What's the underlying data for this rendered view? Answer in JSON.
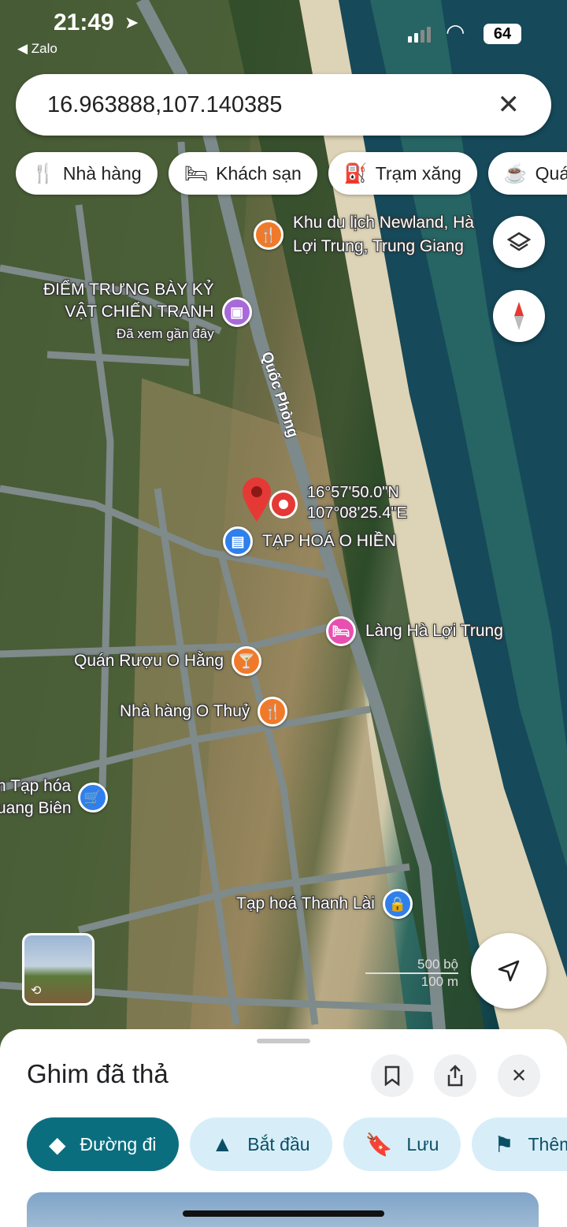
{
  "status_bar": {
    "time": "21:49",
    "back_app": "◀ Zalo",
    "battery": "64"
  },
  "search": {
    "query": "16.963888,107.140385",
    "close_icon": "close-icon"
  },
  "chips": [
    {
      "icon": "restaurant-icon",
      "glyph": "🍴",
      "label": "Nhà hàng"
    },
    {
      "icon": "hotel-icon",
      "glyph": "🛏",
      "label": "Khách sạn"
    },
    {
      "icon": "gas-station-icon",
      "glyph": "⛽",
      "label": "Trạm xăng"
    },
    {
      "icon": "cafe-icon",
      "glyph": "☕",
      "label": "Quán"
    }
  ],
  "map": {
    "road_label": "Quốc Phòng",
    "pin": {
      "lat": "16°57'50.0\"N",
      "lng": "107°08'25.4\"E"
    },
    "pois": [
      {
        "name": "Khu du lịch Newland, Hà",
        "name2": "Lợi Trung, Trung Giang",
        "color": "#f07a2a",
        "icon": "restaurant-icon"
      },
      {
        "name": "ĐIỂM TRƯNG BÀY KỶ",
        "name2": "VẬT CHIẾN TRANH",
        "sub": "Đã xem gần đây",
        "color": "#a86ad8",
        "icon": "museum-icon"
      },
      {
        "name": "TẠP HOÁ O HIỀN",
        "color": "#2f80ed",
        "icon": "shop-icon"
      },
      {
        "name": "Làng Hà Lợi Trung",
        "color": "#e84fb0",
        "icon": "hotel-icon"
      },
      {
        "name": "Quán Rượu O Hằng",
        "color": "#f07a2a",
        "icon": "bar-icon"
      },
      {
        "name": "Nhà hàng O Thuỷ",
        "color": "#f07a2a",
        "icon": "restaurant-icon"
      },
      {
        "name": "n Tạp hóa",
        "name2": "uang Biên",
        "color": "#2f80ed",
        "icon": "cart-icon"
      },
      {
        "name": "Tạp hoá Thanh Lài",
        "color": "#2f80ed",
        "icon": "shopping-bag-icon"
      }
    ],
    "scale": {
      "top": "500 bộ",
      "bottom": "100 m"
    }
  },
  "sheet": {
    "title": "Ghim đã thả",
    "actions": [
      {
        "icon": "directions-icon",
        "glyph": "◆",
        "label": "Đường đi"
      },
      {
        "icon": "navigation-icon",
        "glyph": "▲",
        "label": "Bắt đầu"
      },
      {
        "icon": "bookmark-icon",
        "glyph": "🔖",
        "label": "Lưu"
      },
      {
        "icon": "flag-icon",
        "glyph": "⚑",
        "label": "Thêm"
      }
    ]
  }
}
